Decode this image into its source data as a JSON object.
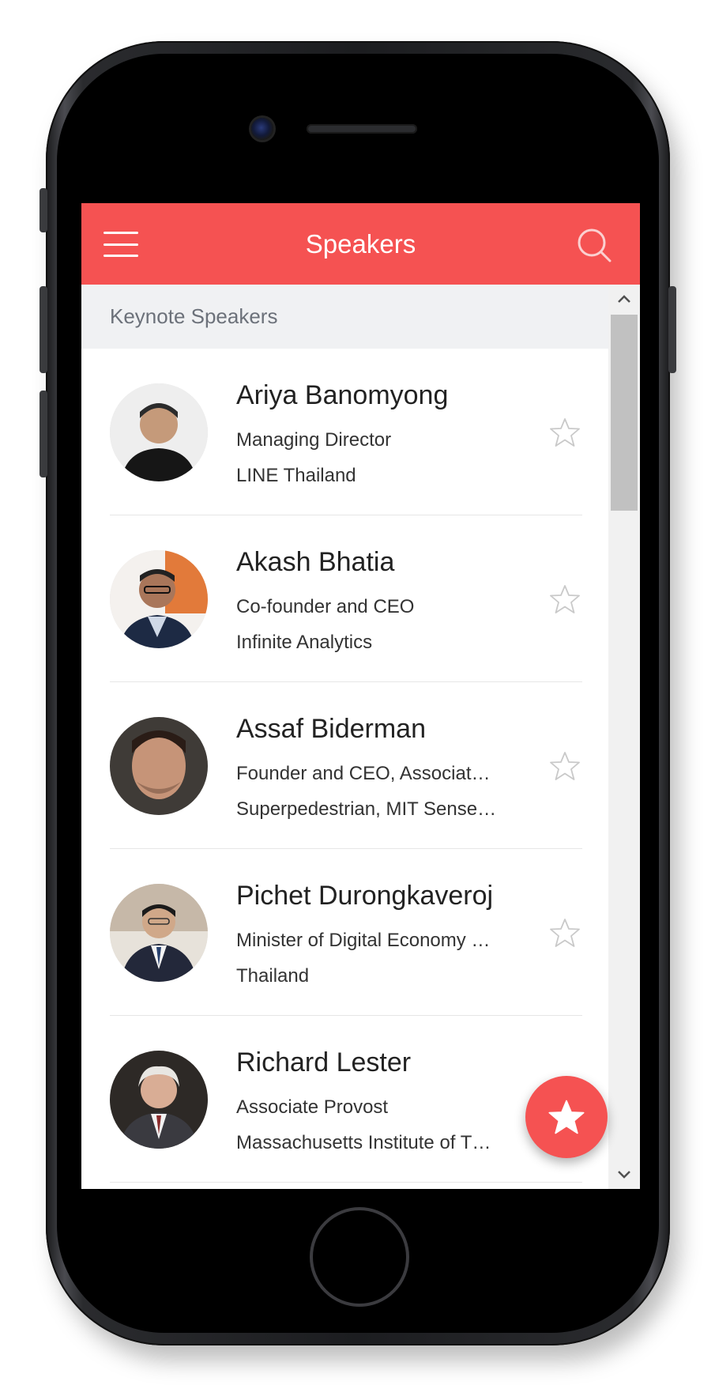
{
  "app": {
    "title": "Speakers",
    "accent_color": "#f55252"
  },
  "toolbar": {
    "menu_icon": "hamburger-menu-icon",
    "search_icon": "search-icon"
  },
  "section": {
    "title": "Keynote Speakers"
  },
  "speakers": [
    {
      "name": "Ariya Banomyong",
      "title": "Managing Director",
      "organization": "LINE Thailand",
      "favorite": false
    },
    {
      "name": "Akash Bhatia",
      "title": "Co-founder and CEO",
      "organization": "Infinite Analytics",
      "favorite": false
    },
    {
      "name": "Assaf Biderman",
      "title": "Founder and CEO, Associat…",
      "organization": "Superpedestrian, MIT Sense…",
      "favorite": false
    },
    {
      "name": "Pichet Durongkaveroj",
      "title": "Minister of Digital Economy …",
      "organization": "Thailand",
      "favorite": false
    },
    {
      "name": "Richard Lester",
      "title": "Associate Provost",
      "organization": "Massachusetts Institute of T…",
      "favorite": false
    }
  ],
  "fab": {
    "icon": "star-icon"
  }
}
